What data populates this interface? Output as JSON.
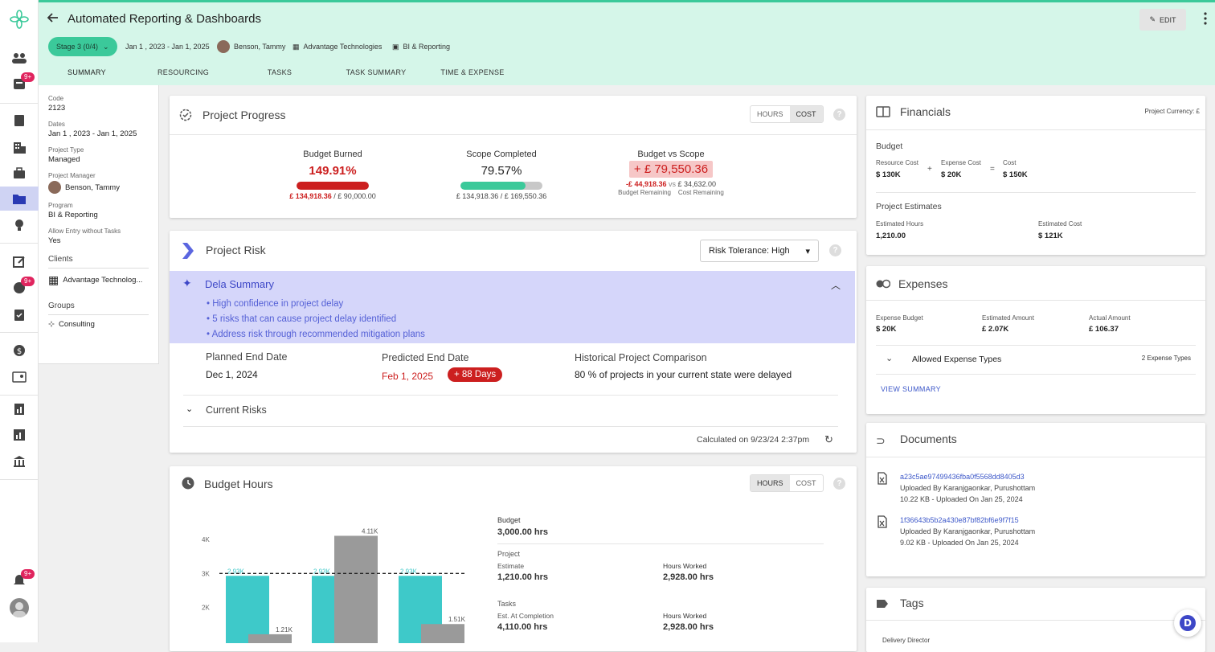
{
  "app": {
    "title": "Automated Reporting & Dashboards",
    "stage": "Stage 3 (0/4)",
    "dates": "Jan 1 , 2023 - Jan 1, 2025",
    "manager": "Benson, Tammy",
    "client": "Advantage Technologies",
    "program": "BI & Reporting",
    "edit_label": "EDIT"
  },
  "tabs": [
    "SUMMARY",
    "RESOURCING",
    "TASKS",
    "TASK SUMMARY",
    "TIME & EXPENSE"
  ],
  "rail": {
    "badge": "9+"
  },
  "left": {
    "code_label": "Code",
    "code": "2123",
    "dates_label": "Dates",
    "dates": "Jan 1 , 2023 - Jan 1, 2025",
    "type_label": "Project Type",
    "type": "Managed",
    "manager_label": "Project Manager",
    "manager": "Benson, Tammy",
    "program_label": "Program",
    "program": "BI & Reporting",
    "entry_label": "Allow Entry without Tasks",
    "entry": "Yes",
    "clients_h": "Clients",
    "client": "Advantage Technolog...",
    "groups_h": "Groups",
    "group": "Consulting"
  },
  "progress": {
    "title": "Project Progress",
    "hours": "HOURS",
    "cost": "COST",
    "burned_h": "Budget Burned",
    "burned_v": "149.91%",
    "burned_frac": 1.0,
    "burned_s1": "£ 134,918.36",
    "burned_s2": " / £ 90,000.00",
    "scope_h": "Scope Completed",
    "scope_v": "79.57%",
    "scope_frac": 0.7957,
    "scope_s": "£ 134,918.36 / £ 169,550.36",
    "bvs_h": "Budget vs Scope",
    "bvs_v": "+ £ 79,550.36",
    "bvs_a": "-£ 44,918.36",
    "bvs_vs": "vs",
    "bvs_b": "£ 34,632.00",
    "bvs_al": "Budget Remaining",
    "bvs_bl": "Cost Remaining"
  },
  "risk": {
    "title": "Project Risk",
    "tolerance": "Risk Tolerance: High",
    "dela_title": "Dela Summary",
    "bullets": [
      "High confidence in project delay",
      "5 risks that can cause project delay identified",
      "Address risk through recommended mitigation plans"
    ],
    "planned_l": "Planned End Date",
    "planned": "Dec 1, 2024",
    "predicted_l": "Predicted End Date",
    "predicted": "Feb 1, 2025",
    "delta": "+ 88 Days",
    "hist_l": "Historical Project Comparison",
    "hist": "80 % of projects in your current state were delayed",
    "current": "Current Risks",
    "calc": "Calculated on 9/23/24 2:37pm"
  },
  "hours": {
    "title": "Budget Hours",
    "hours": "HOURS",
    "cost": "COST",
    "budget_l": "Budget",
    "budget": "3,000.00 hrs",
    "project_l": "Project",
    "est_l": "Estimate",
    "est": "1,210.00 hrs",
    "worked_l": "Hours Worked",
    "worked": "2,928.00 hrs",
    "tasks_l": "Tasks",
    "eac_l": "Est. At Completion",
    "eac": "4,110.00 hrs",
    "worked2_l": "Hours Worked",
    "worked2": "2,928.00 hrs"
  },
  "chart_data": {
    "type": "bar",
    "yticks": [
      "4K",
      "3K",
      "2K"
    ],
    "ylim": [
      0,
      4500
    ],
    "budget_line": 3000,
    "groups": [
      {
        "teal": 2930,
        "teal_label": "2.93K",
        "gray": 1210,
        "gray_label": "1.21K"
      },
      {
        "teal": 2930,
        "teal_label": "2.93K",
        "gray": 4110,
        "gray_label": "4.11K"
      },
      {
        "teal": 2930,
        "teal_label": "2.93K",
        "gray": 1510,
        "gray_label": "1.51K"
      }
    ]
  },
  "financials": {
    "title": "Financials",
    "currency": "Project Currency: £",
    "budget_h": "Budget",
    "res_l": "Resource Cost",
    "res": "$ 130K",
    "plus": "+",
    "exp_l": "Expense Cost",
    "exp": "$ 20K",
    "eq": "=",
    "cost_l": "Cost",
    "cost": "$ 150K",
    "est_h": "Project Estimates",
    "eh_l": "Estimated Hours",
    "eh": "1,210.00",
    "ec_l": "Estimated Cost",
    "ec": "$ 121K"
  },
  "expenses": {
    "title": "Expenses",
    "eb_l": "Expense Budget",
    "eb": "$ 20K",
    "ea_l": "Estimated Amount",
    "ea": "£ 2.07K",
    "aa_l": "Actual Amount",
    "aa": "£ 106.37",
    "types": "Allowed Expense Types",
    "types_c": "2 Expense Types",
    "view": "VIEW SUMMARY"
  },
  "documents": {
    "title": "Documents",
    "items": [
      {
        "name": "a23c5ae97499436fba0f5568dd8405d3",
        "by": "Uploaded By Karanjgaonkar, Purushottam",
        "meta": "10.22 KB - Uploaded On Jan 25, 2024"
      },
      {
        "name": "1f36643b5b2a430e87bf82bf6e9f7f15",
        "by": "Uploaded By Karanjgaonkar, Purushottam",
        "meta": "9.02 KB - Uploaded On Jan 25, 2024"
      }
    ]
  },
  "tags": {
    "title": "Tags",
    "first": "Delivery Director"
  },
  "colors": {
    "accent": "#3bc99a",
    "red": "#cc1f1f",
    "teal": "#3ec9c9",
    "dela": "#d5d6fa"
  }
}
